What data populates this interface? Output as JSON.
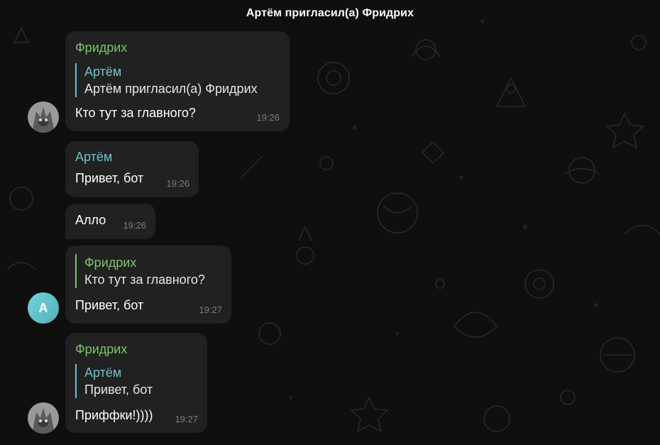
{
  "header": {
    "service_text": "Артём пригласил(а) Фридрих"
  },
  "messages": [
    {
      "sender": "Фридрих",
      "reply": {
        "name": "Артём",
        "text": "Артём пригласил(а) Фридрих"
      },
      "text": "Кто тут за главного?",
      "time": "19:26"
    },
    {
      "sender": "Артём",
      "text": "Привет, бот",
      "time": "19:26"
    },
    {
      "text": "Алло",
      "time": "19:26"
    },
    {
      "reply": {
        "name": "Фридрих",
        "text": "Кто тут за главного?"
      },
      "text": "Привет, бот",
      "time": "19:27",
      "avatar_letter": "А"
    },
    {
      "sender": "Фридрих",
      "reply": {
        "name": "Артём",
        "text": "Привет, бот"
      },
      "text": "Приффки!))))",
      "time": "19:27"
    }
  ],
  "colors": {
    "background": "#0f0f0f",
    "bubble": "#212121",
    "bot_name": "#7cc36b",
    "user_name": "#6cc1d1",
    "timestamp": "#7d7d7d"
  },
  "icons": [
    "wolf-avatar-icon",
    "letter-avatar-icon"
  ]
}
